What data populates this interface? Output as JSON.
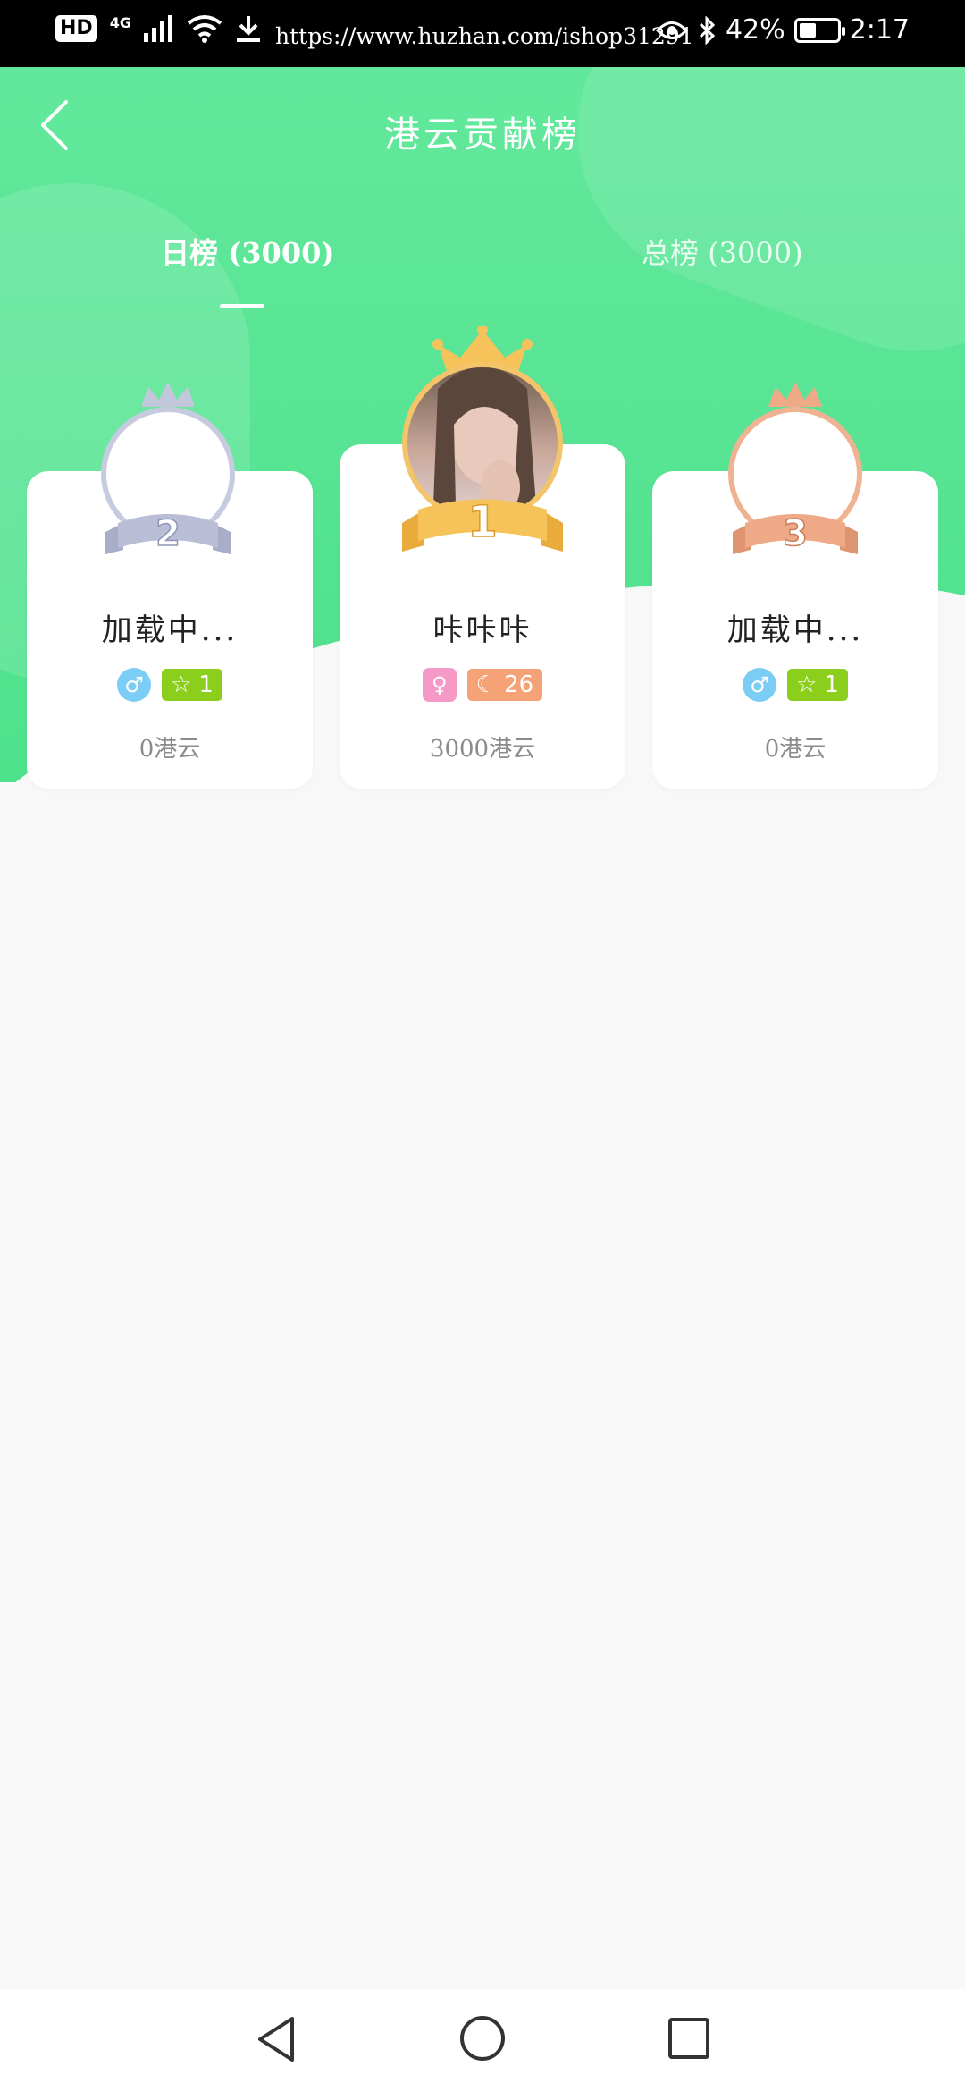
{
  "status_bar": {
    "hd": "HD",
    "network": "4G",
    "url": "https://www.huzhan.com/ishop31291",
    "battery": "42%",
    "time": "2:17"
  },
  "header": {
    "title": "港云贡献榜"
  },
  "tabs": [
    {
      "label": "日榜 (3000)",
      "active": true
    },
    {
      "label": "总榜 (3000)",
      "active": false
    }
  ],
  "ranking": [
    {
      "rank": "2",
      "name": "加载中...",
      "gender": "male",
      "level": "1",
      "level_icon": "star-icon",
      "points": "0港云"
    },
    {
      "rank": "1",
      "name": "咔咔咔",
      "gender": "female",
      "level": "26",
      "level_icon": "moon-icon",
      "points": "3000港云"
    },
    {
      "rank": "3",
      "name": "加载中...",
      "gender": "male",
      "level": "1",
      "level_icon": "star-icon",
      "points": "0港云"
    }
  ],
  "colors": {
    "primary_green": "#5ee69a",
    "silver": "#b9bed6",
    "gold": "#f5c35a",
    "bronze": "#eeaa86"
  },
  "nav": [
    "back-nav",
    "home-nav",
    "recent-nav"
  ]
}
